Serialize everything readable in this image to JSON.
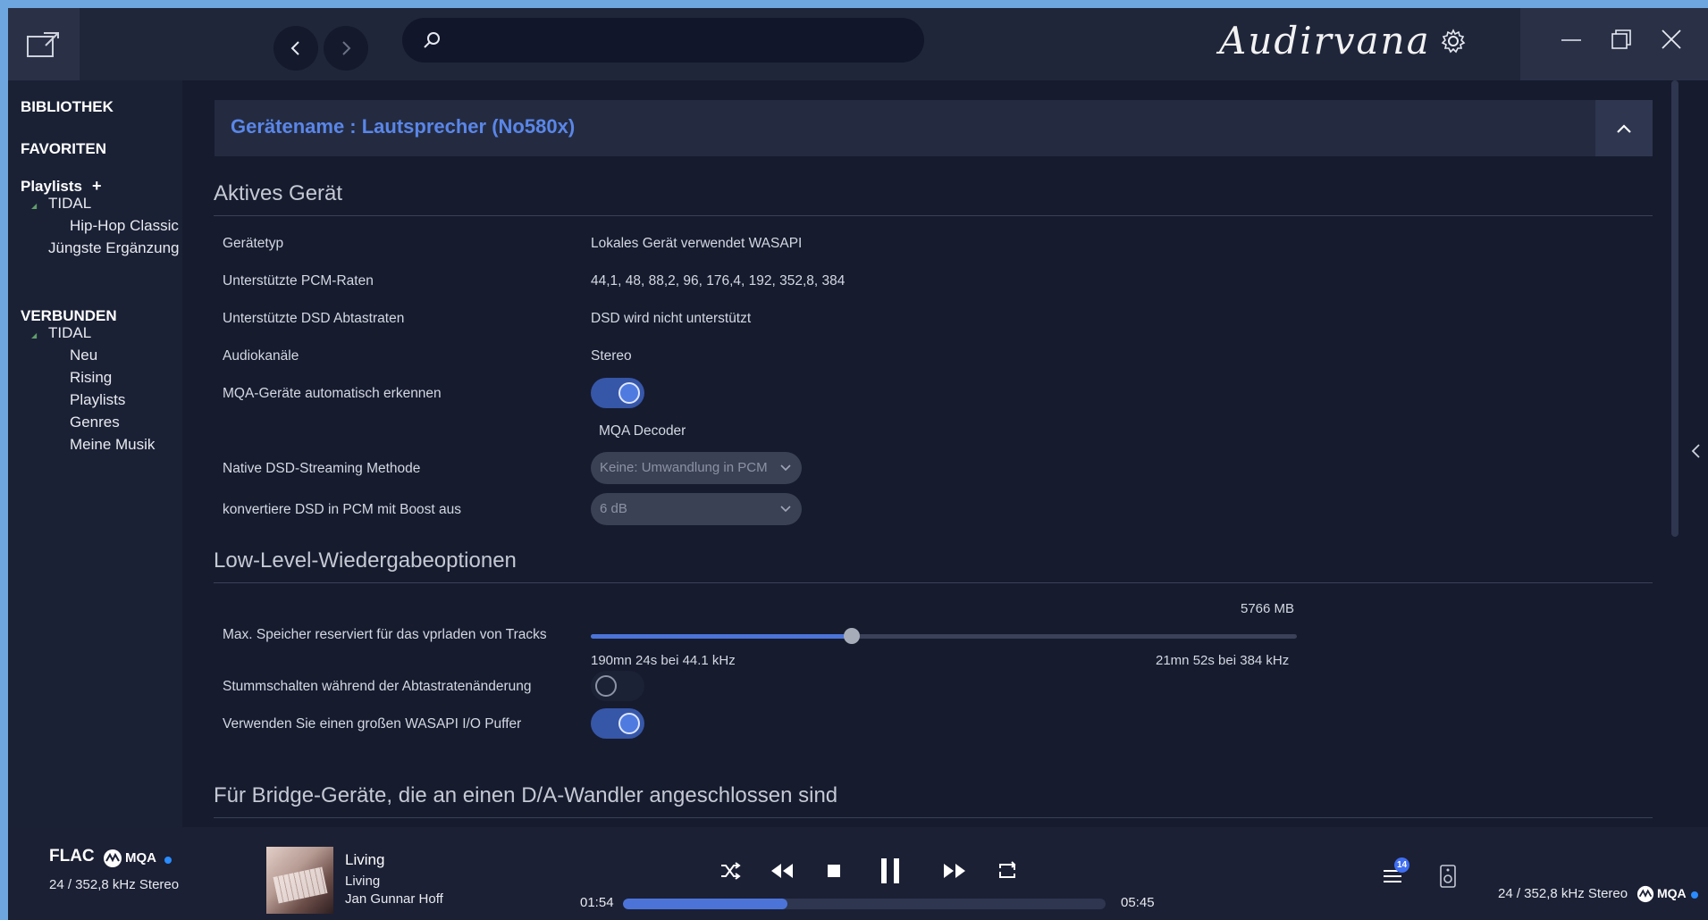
{
  "app": {
    "brand": "Audirvana",
    "search": {
      "placeholder": "",
      "value": ""
    }
  },
  "sidebar": {
    "bibliothek": "BIBLIOTHEK",
    "favoriten": "FAVORITEN",
    "playlists_header": "Playlists",
    "playlists_add": "+",
    "playlists_tidal": "TIDAL",
    "playlist_items": [
      "Hip-Hop Classic",
      "Jüngste Ergänzung"
    ],
    "verbunden_header": "VERBUNDEN",
    "verbunden_tidal": "TIDAL",
    "verbunden_items": [
      "Neu",
      "Rising",
      "Playlists",
      "Genres",
      "Meine Musik"
    ]
  },
  "device": {
    "title": "Gerätename : Lautsprecher (No580x)"
  },
  "active_device": {
    "section_title": "Aktives Gerät",
    "device_type_label": "Gerätetyp",
    "device_type_value": "Lokales Gerät verwendet WASAPI",
    "pcm_label": "Unterstützte PCM-Raten",
    "pcm_value": "44,1, 48, 88,2, 96, 176,4, 192, 352,8, 384",
    "dsd_label": "Unterstützte DSD Abtastraten",
    "dsd_value": "DSD wird nicht unterstützt",
    "channels_label": "Audiokanäle",
    "channels_value": "Stereo",
    "mqa_label": "MQA-Geräte automatisch erkennen",
    "mqa_toggle": true,
    "mqa_decoder": "MQA Decoder",
    "native_dsd_label": "Native DSD-Streaming Methode",
    "native_dsd_value": "Keine: Umwandlung in PCM",
    "convert_dsd_label": "konvertiere DSD in PCM mit Boost aus",
    "convert_dsd_value": "6 dB"
  },
  "low_level": {
    "section_title": "Low-Level-Wiedergabeoptionen",
    "max_mem_value": "5766 MB",
    "max_mem_label": "Max. Speicher reserviert für das vprladen von Tracks",
    "max_mem_fraction": 0.37,
    "min_note": "190mn 24s bei 44.1 kHz",
    "max_note": "21mn 52s bei 384 kHz",
    "mute_label": "Stummschalten während der Abtastratenänderung",
    "mute_toggle": false,
    "wasapi_label": "Verwenden Sie einen großen WASAPI I/O Puffer",
    "wasapi_toggle": true
  },
  "bridge": {
    "section_title": "Für Bridge-Geräte, die an einen D/A-Wandler angeschlossen sind"
  },
  "player": {
    "format": "FLAC",
    "mqa": "MQA",
    "rate_left": "24 / 352,8 kHz Stereo",
    "track_title": "Living",
    "track_album": "Living",
    "track_artist": "Jan Gunnar Hoff",
    "elapsed": "01:54",
    "total": "05:45",
    "progress_fraction": 0.34,
    "queue_count": "14",
    "rate_right": "24 / 352,8 kHz Stereo",
    "accent": "#4c74d8"
  }
}
